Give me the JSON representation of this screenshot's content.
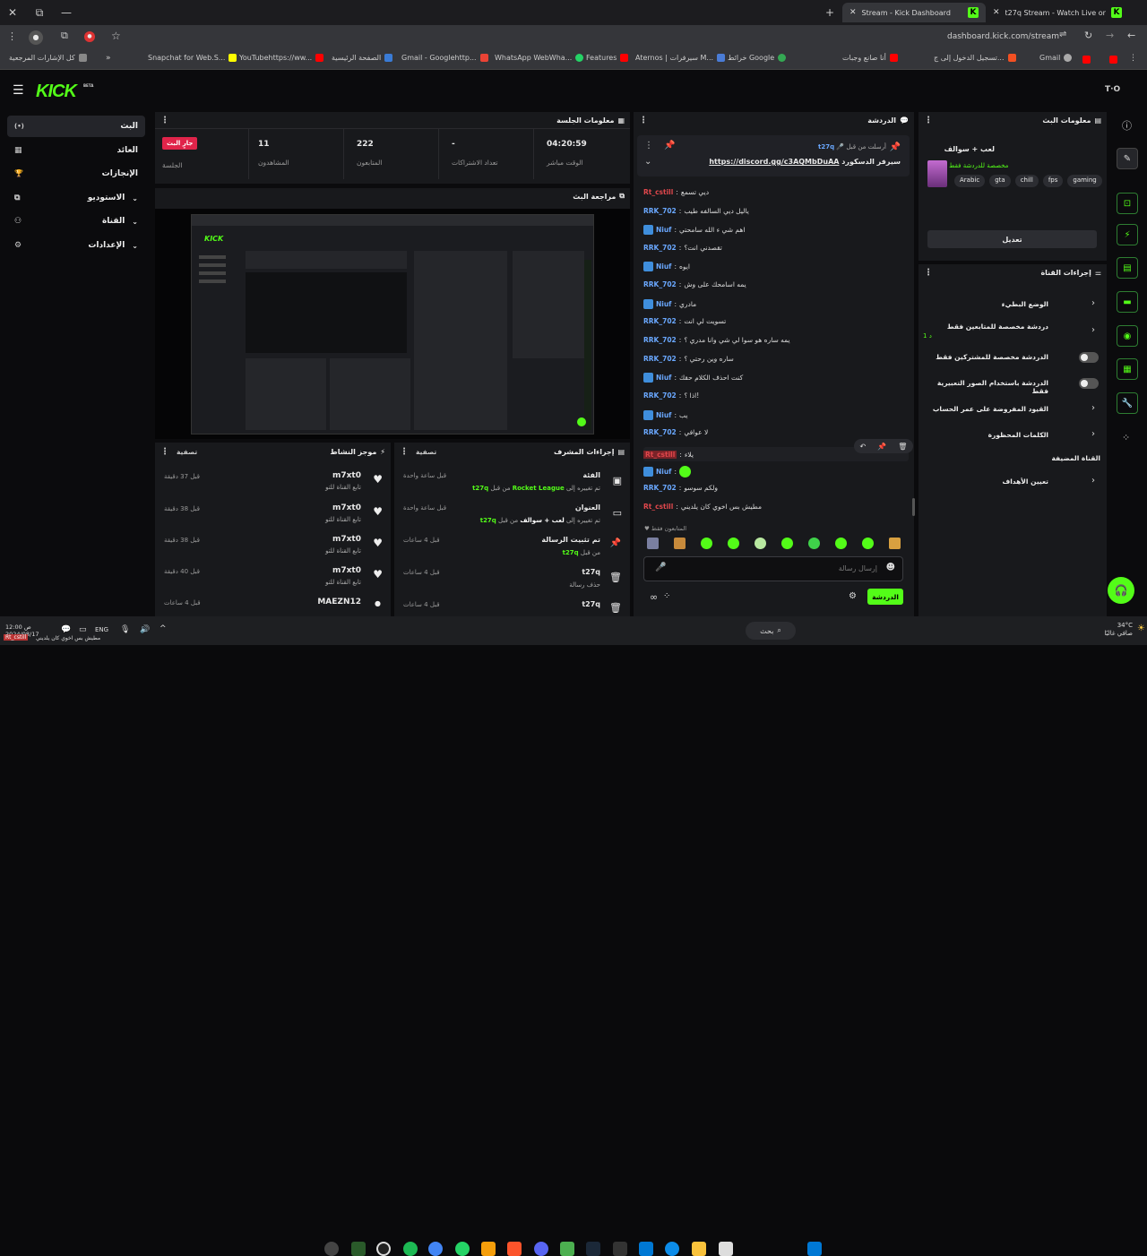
{
  "browser": {
    "tabs": [
      {
        "title": "Stream - Kick Dashboard",
        "active": true
      },
      {
        "title": "t27q Stream - Watch Live on K",
        "active": false
      }
    ],
    "url": "dashboard.kick.com/stream",
    "bookmarks": [
      "كل الإشارات المرجعية",
      "Snapchat for Web.S...",
      "YouTubehttps://ww...",
      "الصفحة الرئيسية",
      "Gmail - Googlehttp...",
      "WhatsApp WebWha...",
      "Features",
      "Aternos | سيرفرات M...",
      "خرائط Google",
      "أنا صانع وجبات",
      "تسجيل الدخول إلى ج...",
      "Gmail"
    ]
  },
  "app": {
    "logo": "KICK",
    "beta": "BETA",
    "user_badge": "T·O",
    "nav": [
      {
        "label": "البث",
        "icon": "(•)",
        "active": true,
        "chevron": false
      },
      {
        "label": "العائد",
        "icon": "▦",
        "active": false,
        "chevron": false
      },
      {
        "label": "الإنجازات",
        "icon": "🏆",
        "active": false,
        "chevron": false
      },
      {
        "label": "الاستوديو",
        "icon": "⧉",
        "active": false,
        "chevron": true
      },
      {
        "label": "القناة",
        "icon": "⚇",
        "active": false,
        "chevron": true
      },
      {
        "label": "الإعدادات",
        "icon": "⚙",
        "active": false,
        "chevron": true
      }
    ]
  },
  "session": {
    "title": "معلومات الجلسة",
    "live_badge": "جارٍ البث",
    "session_label": "الجلسة",
    "stats": [
      {
        "value": "11",
        "label": "المشاهدون"
      },
      {
        "value": "222",
        "label": "المتابعون"
      },
      {
        "value": "-",
        "label": "تعداد الاشتراكات"
      },
      {
        "value": "04:20:59",
        "label": "الوقت مباشر"
      }
    ]
  },
  "preview": {
    "title": "مراجعة البث"
  },
  "activity": {
    "title": "موجز النشاط",
    "filter": "تصفية",
    "items": [
      {
        "user": "m7xt0",
        "desc": "تابع القناة للتو",
        "time": "قبل 37 دقيقة"
      },
      {
        "user": "m7xt0",
        "desc": "تابع القناة للتو",
        "time": "قبل 38 دقيقة"
      },
      {
        "user": "m7xt0",
        "desc": "تابع القناة للتو",
        "time": "قبل 38 دقيقة"
      },
      {
        "user": "m7xt0",
        "desc": "تابع القناة للتو",
        "time": "قبل 40 دقيقة"
      },
      {
        "user": "MAEZN12",
        "desc": "",
        "time": "قبل 4 ساعات"
      }
    ]
  },
  "mod_actions": {
    "title": "إجراءات المشرف",
    "filter": "تصفية",
    "items": [
      {
        "title": "الفئة",
        "desc_pre": "t27q",
        "desc_mid": " من قبل ",
        "desc_post": "تم تغييره إلى ",
        "highlight": "Rocket League",
        "time": "قبل ساعة واحدة"
      },
      {
        "title": "العنوان",
        "desc_pre": "t27q",
        "desc_mid": " من قبل ",
        "desc_post": "تم تغييره إلى ",
        "highlight": "لعب + سوالف",
        "time": "قبل ساعة واحدة"
      },
      {
        "title": "تم تثبيت الرسالة",
        "desc_pre": "t27q",
        "desc_mid": " من قبل ",
        "desc_post": "",
        "highlight": "",
        "time": "قبل 4 ساعات"
      },
      {
        "title": "t27q",
        "desc_pre": "",
        "desc_mid": "",
        "desc_post": "حذف رسالة",
        "highlight": "",
        "time": "قبل 4 ساعات"
      },
      {
        "title": "t27q",
        "desc_pre": "",
        "desc_mid": "",
        "desc_post": "",
        "highlight": "",
        "time": "قبل 4 ساعات"
      }
    ]
  },
  "chat": {
    "title": "الدردشة",
    "pinned_by": "t27q",
    "pinned_label": "أرسلت من قبل",
    "pinned_text": "سيرفر الدسكورد",
    "pinned_link": "https://discord.gg/c3AQMbDuAA",
    "messages": [
      {
        "user": "Rt_cstill",
        "color": "red",
        "badge": false,
        "text": "ديي تسمع"
      },
      {
        "user": "RRK_702",
        "color": "blue",
        "badge": false,
        "text": "ياليل ديي السالفه طيب"
      },
      {
        "user": "Niuf",
        "color": "blue",
        "badge": true,
        "text": "اهم شي ء الله سامحتي"
      },
      {
        "user": "RRK_702",
        "color": "blue",
        "badge": false,
        "text": "تقصدني انت؟"
      },
      {
        "user": "Niuf",
        "color": "blue",
        "badge": true,
        "text": "ايوه"
      },
      {
        "user": "RRK_702",
        "color": "blue",
        "badge": false,
        "text": "يمه اسامحك على وش"
      },
      {
        "user": "Niuf",
        "color": "blue",
        "badge": true,
        "text": "مادري"
      },
      {
        "user": "RRK_702",
        "color": "blue",
        "badge": false,
        "text": "تسويت لي انت"
      },
      {
        "user": "RRK_702",
        "color": "blue",
        "badge": false,
        "text": "يمه ساره هو سوا لي شي وانا مدري ؟"
      },
      {
        "user": "RRK_702",
        "color": "blue",
        "badge": false,
        "text": "ساره وين رحتي ؟"
      },
      {
        "user": "Niuf",
        "color": "blue",
        "badge": true,
        "text": "كنت احذف الكلام حقك"
      },
      {
        "user": "RRK_702",
        "color": "blue",
        "badge": false,
        "text": "اذا ؟!"
      },
      {
        "user": "Niuf",
        "color": "blue",
        "badge": true,
        "text": "يب"
      },
      {
        "user": "RRK_702",
        "color": "blue",
        "badge": false,
        "text": "لا عوافي"
      },
      {
        "user": "Rt_cstill",
        "color": "red",
        "badge": false,
        "text": "يلاء"
      },
      {
        "user": "Niuf",
        "color": "blue",
        "badge": true,
        "text": ""
      },
      {
        "user": "RRK_702",
        "color": "blue",
        "badge": false,
        "text": "ولكم سوسو"
      },
      {
        "user": "Rt_cstill",
        "color": "red",
        "badge": false,
        "text": "مطيش بس اخوي كان يلديني"
      }
    ],
    "followers_only": "المتابعون فقط",
    "input_placeholder": "إرسال رسالة",
    "send_label": "الدردشة"
  },
  "stream_info": {
    "title": "معلومات البث",
    "stream_title": "لعب + سوالف",
    "chat_mode": "مخصصة للدردشة فقط",
    "tags": [
      "Arabic",
      "gta",
      "chill",
      "fps",
      "gaming"
    ],
    "edit_label": "تعديل"
  },
  "channel_actions": {
    "title": "إجراءات القناة",
    "items": [
      {
        "label": "الوضع البطيء",
        "control": "chevron",
        "sub": ""
      },
      {
        "label": "دردشة مخصصة للمتابعين فقط",
        "control": "chevron",
        "sub": "1 د"
      },
      {
        "label": "الدردشة مخصصة للمشتركين فقط",
        "control": "toggle",
        "sub": ""
      },
      {
        "label": "الدردشة باستخدام الصور التعبيرية فقط",
        "control": "toggle",
        "sub": ""
      },
      {
        "label": "القيود المفروضة على عمر الحساب",
        "control": "chevron",
        "sub": ""
      },
      {
        "label": "الكلمات المحظورة",
        "control": "chevron",
        "sub": ""
      },
      {
        "label": "القناة المضيفة",
        "control": "none",
        "sub": ""
      },
      {
        "label": "تعيين الأهداف",
        "control": "chevron",
        "sub": ""
      }
    ]
  },
  "taskbar": {
    "weather_temp": "34°C",
    "weather_desc": "صافي غالبًا",
    "search": "بحث",
    "lang": "ENG",
    "time": "12:00 ص",
    "date": "2024/08/17",
    "notification": "مطيش بس اخوي كان يلديني",
    "notification_user": "Rt_cstill"
  },
  "colors": {
    "accent": "#53fc18",
    "panel": "#18191c",
    "bg": "#0b0b0d",
    "live": "#e0244a",
    "chat_blue": "#6aa8ff",
    "chat_red": "#e0474c"
  }
}
